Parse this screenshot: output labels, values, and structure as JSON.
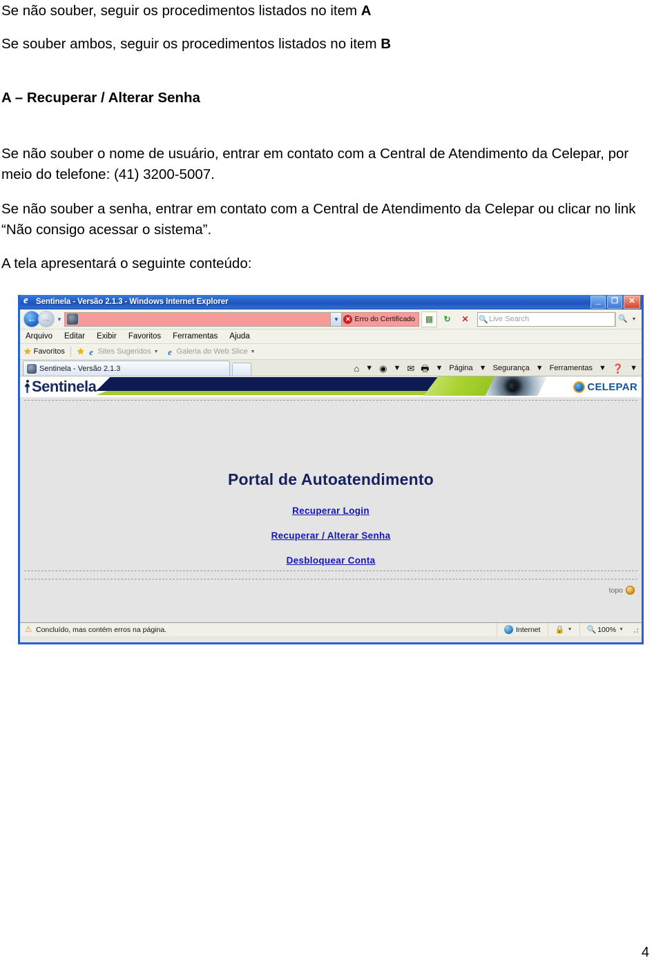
{
  "document": {
    "line_a": "Se não souber, seguir os procedimentos listados no item ",
    "line_a_bold": "A",
    "line_b": "Se souber ambos, seguir os procedimentos listados no item ",
    "line_b_bold": "B",
    "heading_a": "A – Recuperar / Alterar Senha",
    "paragraph_1": "Se não souber o nome de usuário, entrar em contato com a Central de Atendimento da Celepar, por meio do telefone: (41) 3200-5007.",
    "paragraph_2": "Se não souber a senha, entrar em contato com a Central de Atendimento da Celepar ou clicar no link “Não consigo acessar o sistema”.",
    "paragraph_3": "A tela apresentará o seguinte conteúdo:",
    "page_number": "4"
  },
  "browser": {
    "title": "Sentinela - Versão 2.1.3 - Windows Internet Explorer",
    "window_buttons": {
      "minimize": "_",
      "maximize": "❐",
      "close": "✕"
    },
    "address_bar": {
      "url_value": "",
      "certificate_error_label": "Erro do Certificado",
      "dropdown_caret": "▼"
    },
    "search": {
      "placeholder": "Live Search",
      "value": ""
    },
    "menu": [
      "Arquivo",
      "Editar",
      "Exibir",
      "Favoritos",
      "Ferramentas",
      "Ajuda"
    ],
    "favorites_bar": {
      "favorites_label": "Favoritos",
      "items": [
        "Sites Sugeridos",
        "Galeria do Web Slice"
      ]
    },
    "tab": {
      "title": "Sentinela - Versão 2.1.3"
    },
    "command_bar": [
      "Página",
      "Segurança",
      "Ferramentas"
    ],
    "status_bar": {
      "message": "Concluído, mas contém erros na página.",
      "zone": "Internet",
      "zoom": "100%"
    }
  },
  "page": {
    "logo_text": "Sentinela",
    "celepar_text": "CELEPAR",
    "title": "Portal de Autoatendimento",
    "links": [
      "Recuperar Login",
      "Recuperar / Alterar Senha",
      "Desbloquear Conta"
    ],
    "topo_label": "topo"
  },
  "colors": {
    "titlebar_blue": "#2560c8",
    "window_border": "#2a5fd4",
    "cert_error_red": "#f79a9a",
    "banner_navy": "#0d1b52",
    "banner_green": "#a6cc29",
    "link_blue": "#1414b4",
    "page_bg": "#e4e4e4",
    "celepar_blue": "#16559e"
  }
}
